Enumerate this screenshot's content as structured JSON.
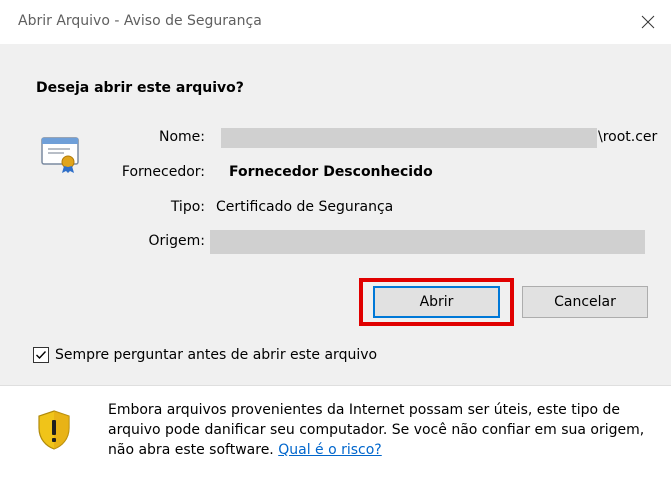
{
  "window": {
    "title": "Abrir Arquivo - Aviso de Segurança",
    "close_icon": "close-icon"
  },
  "prompt": {
    "question": "Deseja abrir este arquivo?"
  },
  "file_info": {
    "icon": "certificate-icon",
    "name_label": "Nome:",
    "name_value": "\\root.cer",
    "publisher_label": "Fornecedor:",
    "publisher_value": "Fornecedor Desconhecido",
    "type_label": "Tipo:",
    "type_value": "Certificado de Segurança",
    "origin_label": "Origem:"
  },
  "buttons": {
    "open_label": "Abrir",
    "cancel_label": "Cancelar"
  },
  "checkbox": {
    "label": "Sempre perguntar antes de abrir este arquivo",
    "checked": true
  },
  "footer": {
    "icon": "shield-warning-icon",
    "warning_text": "Embora arquivos provenientes da Internet possam ser úteis, este tipo de arquivo pode danificar seu computador. Se você não confiar em sua origem, não abra este software.",
    "risk_link": "Qual é o risco?"
  },
  "colors": {
    "highlight_border": "#e00000",
    "link": "#0066cc",
    "panel_bg": "#f0f0f0"
  }
}
